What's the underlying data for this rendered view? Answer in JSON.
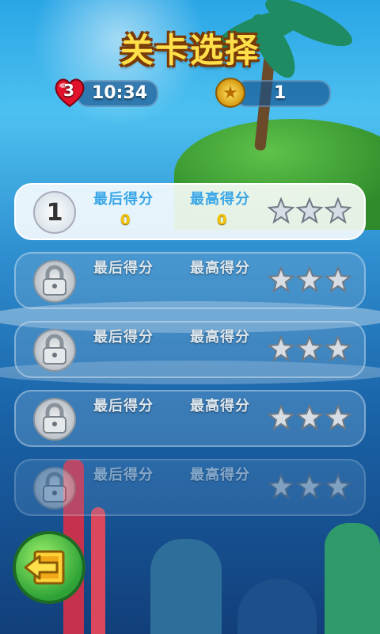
{
  "header": {
    "title": "关卡选择"
  },
  "status": {
    "lives": "3",
    "timer": "10:34",
    "coins": "1"
  },
  "labels": {
    "last_score": "最后得分",
    "high_score": "最高得分"
  },
  "levels": [
    {
      "number": "1",
      "locked": false,
      "last_score": "0",
      "high_score": "0",
      "stars": 0
    },
    {
      "locked": true,
      "stars": 0
    },
    {
      "locked": true,
      "stars": 0
    },
    {
      "locked": true,
      "stars": 0
    },
    {
      "locked": true,
      "stars": 0
    }
  ],
  "icons": {
    "lives": "heart-icon",
    "coins": "star-coin-icon",
    "lock": "lock-icon",
    "star": "star-icon",
    "exit": "exit-arrow-icon"
  },
  "colors": {
    "title": "#ffe04a",
    "label_active": "#38a6e8",
    "score": "#f2c400",
    "exit_button": "#2ea236"
  }
}
